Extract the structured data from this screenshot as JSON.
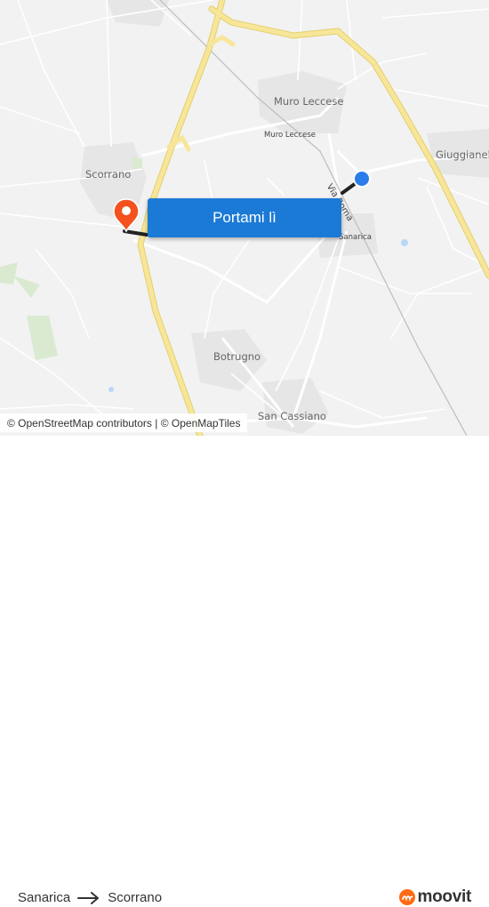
{
  "map": {
    "places": {
      "muro_big": "Muro Leccese",
      "muro_small": "Muro Leccese",
      "scorrano": "Scorrano",
      "giuggianello": "Giuggianello",
      "sanarica": "Sanarica",
      "botrugno": "Botrugno",
      "san_cassiano": "San Cassiano",
      "via_roma": "Via Roma"
    },
    "cta_label": "Portami lì",
    "attribution": "© OpenStreetMap contributors | © OpenMapTiles",
    "colors": {
      "route": "#222222",
      "origin": "#2b7de9",
      "destination": "#f4511e",
      "cta": "#1b7ad6",
      "motorway": "#f5e38a"
    }
  },
  "footer": {
    "from": "Sanarica",
    "to": "Scorrano",
    "brand": "moovit",
    "brand_color": "#ff6a13"
  }
}
